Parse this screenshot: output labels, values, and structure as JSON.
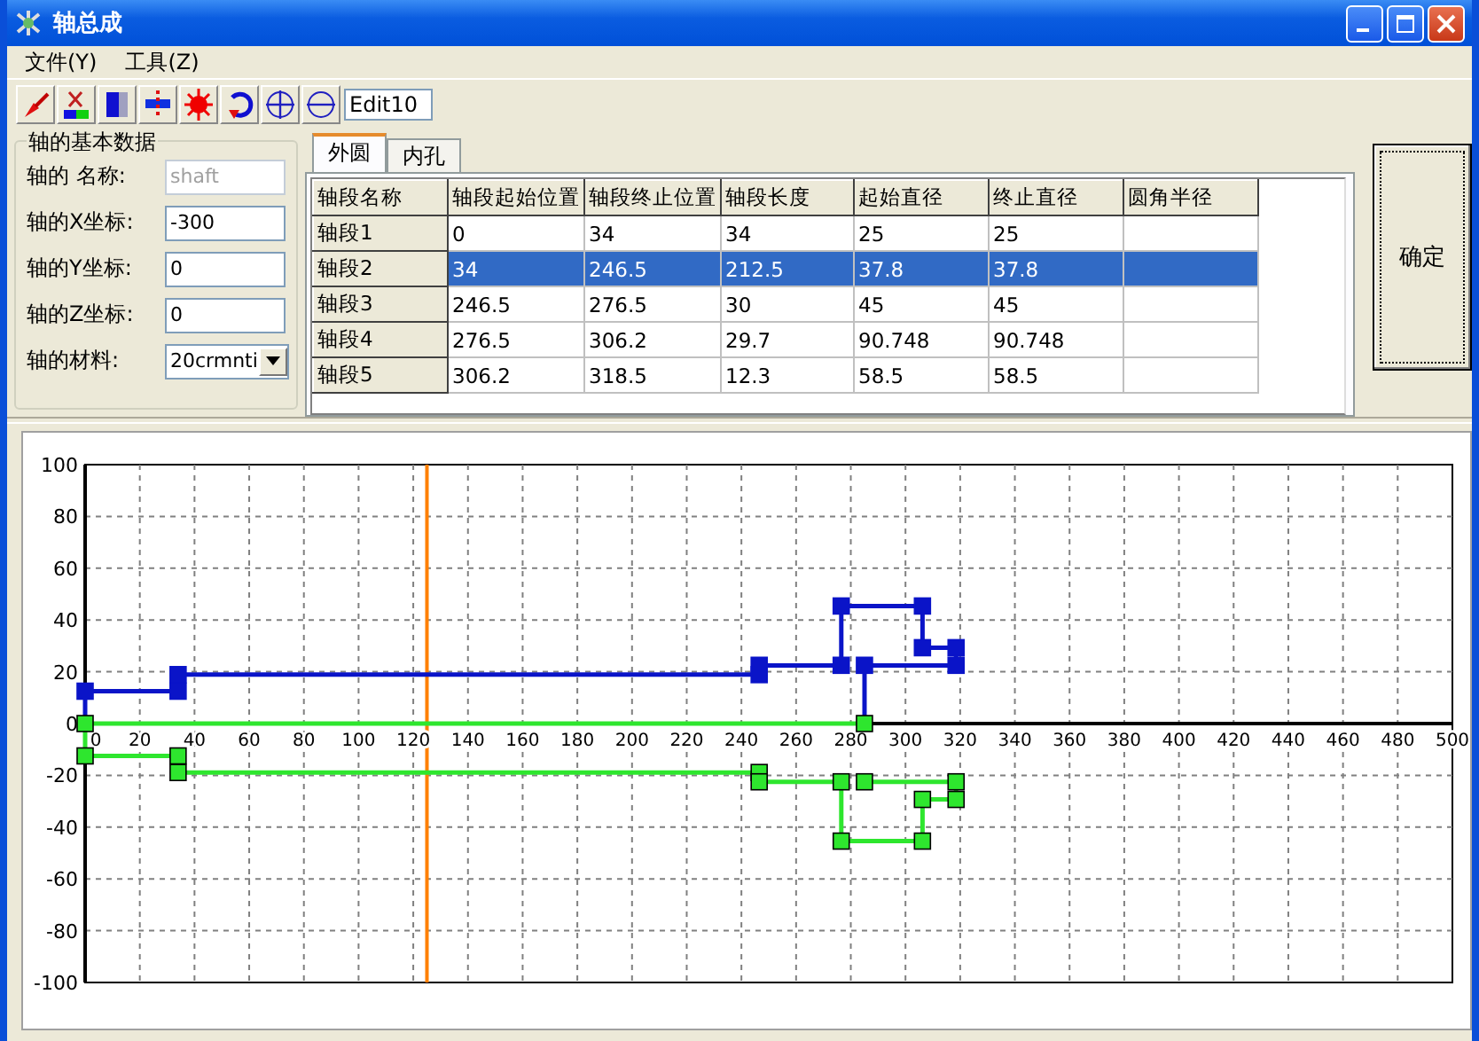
{
  "window": {
    "title": "轴总成"
  },
  "menu": [
    {
      "label": "文件(Y)"
    },
    {
      "label": "工具(Z)"
    }
  ],
  "toolbar": {
    "buttons": [
      {
        "kind": "arrow"
      },
      {
        "kind": "cut"
      },
      {
        "kind": "block"
      },
      {
        "kind": "split"
      },
      {
        "kind": "burst"
      },
      {
        "kind": "rotate"
      },
      {
        "kind": "cross"
      },
      {
        "kind": "line"
      }
    ],
    "field": {
      "value": "Edit10"
    }
  },
  "basic_data": {
    "title": "轴的基本数据",
    "fields": [
      {
        "label": "轴的 名称:",
        "value": "shaft",
        "disabled": true,
        "kind": "text"
      },
      {
        "label": "轴的X坐标:",
        "value": "-300",
        "disabled": false,
        "kind": "text"
      },
      {
        "label": "轴的Y坐标:",
        "value": "0",
        "disabled": false,
        "kind": "text"
      },
      {
        "label": "轴的Z坐标:",
        "value": "0",
        "disabled": false,
        "kind": "text"
      },
      {
        "label": "轴的材料:",
        "value": "20crmnti",
        "disabled": false,
        "kind": "combo"
      }
    ]
  },
  "tabs": [
    {
      "label": "外圆",
      "selected": true
    },
    {
      "label": "内孔",
      "selected": false
    }
  ],
  "table": {
    "columns": [
      "轴段名称",
      "轴段起始位置",
      "轴段终止位置",
      "轴段长度",
      "起始直径",
      "终止直径",
      "圆角半径"
    ],
    "rows": [
      {
        "cells": [
          "轴段1",
          "0",
          "34",
          "34",
          "25",
          "25"
        ],
        "selected": false
      },
      {
        "cells": [
          "轴段2",
          "34",
          "246.5",
          "212.5",
          "37.8",
          "37.8"
        ],
        "selected": true
      },
      {
        "cells": [
          "轴段3",
          "246.5",
          "276.5",
          "30",
          "45",
          "45"
        ],
        "selected": false
      },
      {
        "cells": [
          "轴段4",
          "276.5",
          "306.2",
          "29.7",
          "90.748",
          "90.748"
        ],
        "selected": false
      },
      {
        "cells": [
          "轴段5",
          "306.2",
          "318.5",
          "12.3",
          "58.5",
          "58.5"
        ],
        "selected": false
      }
    ]
  },
  "ok_button": "确定",
  "chart": {
    "chart_data": {
      "type": "line",
      "xlim": [
        0,
        500
      ],
      "ylim": [
        -100,
        100
      ],
      "xticks": [
        0,
        20,
        40,
        60,
        80,
        100,
        120,
        140,
        160,
        180,
        200,
        220,
        240,
        260,
        280,
        300,
        320,
        340,
        360,
        380,
        400,
        420,
        440,
        460,
        480,
        500
      ],
      "yticks": [
        -100,
        -80,
        -60,
        -40,
        -20,
        0,
        20,
        40,
        60,
        80,
        100
      ],
      "grid": true,
      "series": [
        {
          "color": "#0a14c8",
          "marker": "square",
          "x": [
            0,
            0,
            34,
            34,
            246.5,
            246.5,
            276.5,
            276.5,
            306.2,
            306.2,
            318.5,
            318.5,
            285,
            285
          ],
          "values": [
            0,
            12.5,
            12.5,
            18.9,
            18.9,
            22.5,
            22.5,
            45.4,
            45.4,
            29.3,
            29.3,
            22.5,
            22.5,
            0
          ]
        },
        {
          "color": "#2ee62e",
          "marker": "square",
          "x": [
            285,
            0,
            0,
            34,
            34,
            246.5,
            246.5,
            276.5,
            276.5,
            306.2,
            306.2,
            318.5,
            318.5,
            285
          ],
          "values": [
            0,
            0,
            -12.5,
            -12.5,
            -18.9,
            -18.9,
            -22.5,
            -22.5,
            -45.4,
            -45.4,
            -29.3,
            -29.3,
            -22.5,
            -22.5
          ]
        }
      ],
      "ref_lines": [
        {
          "axis": "x",
          "value": 125,
          "color": "#ff8000"
        }
      ]
    }
  }
}
